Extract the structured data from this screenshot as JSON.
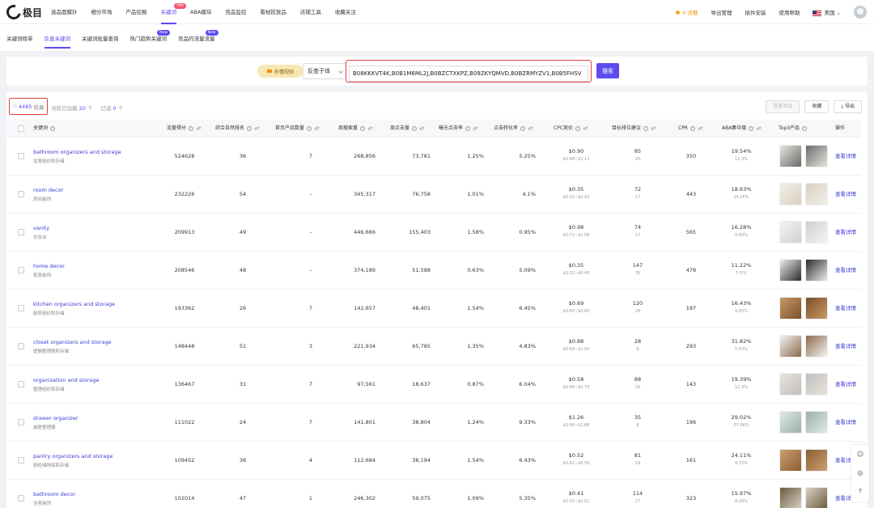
{
  "logo": {
    "text": "极目"
  },
  "nav": {
    "items": [
      {
        "label": "选品面膜针"
      },
      {
        "label": "细分市场"
      },
      {
        "label": "产品挖掘"
      },
      {
        "label": "关键词",
        "badge": "Hot",
        "active": true
      },
      {
        "label": "ABA模块"
      },
      {
        "label": "竞品监控"
      },
      {
        "label": "看帖投放品"
      },
      {
        "label": "店铺工具"
      },
      {
        "label": "收藏关注"
      }
    ]
  },
  "topright": {
    "coin": "0 点数",
    "export": "导出管理",
    "plugin": "插件安装",
    "help": "使用帮助",
    "country": "美国"
  },
  "subtabs": [
    {
      "label": "关键词榜单"
    },
    {
      "label": "反查关键词",
      "active": true
    },
    {
      "label": "关键词批量查询"
    },
    {
      "label": "热门趋势关键词",
      "badge": "New"
    },
    {
      "label": "竞品的流量流量",
      "badge": "New"
    }
  ],
  "search": {
    "video_label": "秒懂视频",
    "type_value": "反查子体",
    "asin_value": "B08KKKVT4K,B0B1M6ML2J,B0BZCTXKPZ,B09ZKYQMVD,B0BZRMYZV1,B0B5FHSV",
    "button": "搜索"
  },
  "summary": {
    "count": "4485",
    "count_label": "结果",
    "page_label": "当前已加载",
    "page_count": "20",
    "page_unit": "个",
    "selected_label": "已选",
    "selected_count": "0",
    "selected_unit": "个"
  },
  "actions": {
    "batch": "批量添加",
    "collect": "收藏",
    "export": "导出"
  },
  "columns": [
    "关键词",
    "流量得分",
    "综合自然排名",
    "首页产品数量",
    "周搜索量",
    "周点击量",
    "曝光点击率",
    "点击转化率",
    "CPC竞价",
    "目标排位建议",
    "CPR",
    "ABA集中度",
    "Top3产品",
    "操作"
  ],
  "rows": [
    {
      "en": "bathroom organizers and storage",
      "cn": "浴室组织和存储",
      "score": "524628",
      "rank": "36",
      "first": "7",
      "search": "268,856",
      "click": "73,781",
      "ctr": "1.25%",
      "cvr": "5.25%",
      "cpc": "$0.90",
      "cpc_range": "$0.68~$1.13",
      "target": "85",
      "target_sub": "20",
      "cpr": "350",
      "aba": "19.54%",
      "aba_sub": "11.3%",
      "link": "查看详情"
    },
    {
      "en": "room decor",
      "cn": "房间装饰",
      "score": "232226",
      "rank": "54",
      "first": "–",
      "search": "345,317",
      "click": "76,758",
      "ctr": "1.01%",
      "cvr": "4.1%",
      "cpc": "$0.35",
      "cpc_range": "$0.32~$0.42",
      "target": "72",
      "target_sub": "17",
      "cpr": "443",
      "aba": "18.63%",
      "aba_sub": "14.26%",
      "link": "查看详情"
    },
    {
      "en": "vanity",
      "cn": "化妆台",
      "score": "209913",
      "rank": "49",
      "first": "–",
      "search": "446,666",
      "click": "155,403",
      "ctr": "1.58%",
      "cvr": "0.95%",
      "cpc": "$0.98",
      "cpc_range": "$0.72~$1.08",
      "target": "74",
      "target_sub": "17",
      "cpr": "565",
      "aba": "16.28%",
      "aba_sub": "9.83%",
      "link": "查看详情"
    },
    {
      "en": "home decor",
      "cn": "家居装饰",
      "score": "208546",
      "rank": "48",
      "first": "–",
      "search": "374,189",
      "click": "51,588",
      "ctr": "0.63%",
      "cvr": "5.09%",
      "cpc": "$0.35",
      "cpc_range": "$0.32~$0.40",
      "target": "147",
      "target_sub": "35",
      "cpr": "478",
      "aba": "11.22%",
      "aba_sub": "5.5%",
      "link": "查看详情"
    },
    {
      "en": "kitchen organizers and storage",
      "cn": "厨房组织和存储",
      "score": "193362",
      "rank": "26",
      "first": "7",
      "search": "142,657",
      "click": "48,401",
      "ctr": "1.54%",
      "cvr": "6.45%",
      "cpc": "$0.69",
      "cpc_range": "$0.60~$0.80",
      "target": "120",
      "target_sub": "28",
      "cpr": "197",
      "aba": "16.43%",
      "aba_sub": "9.83%",
      "link": "查看详情"
    },
    {
      "en": "closet organizers and storage",
      "cn": "壁橱整理器和存储",
      "score": "148448",
      "rank": "51",
      "first": "3",
      "search": "221,934",
      "click": "65,785",
      "ctr": "1.35%",
      "cvr": "4.83%",
      "cpc": "$0.88",
      "cpc_range": "$0.69~$1.04",
      "target": "28",
      "target_sub": "6",
      "cpr": "293",
      "aba": "31.82%",
      "aba_sub": "5.03%",
      "link": "查看详情"
    },
    {
      "en": "organization and storage",
      "cn": "整理组织和存储",
      "score": "136467",
      "rank": "31",
      "first": "7",
      "search": "97,561",
      "click": "18,637",
      "ctr": "0.87%",
      "cvr": "6.04%",
      "cpc": "$0.58",
      "cpc_range": "$0.48~$0.73",
      "target": "88",
      "target_sub": "20",
      "cpr": "143",
      "aba": "19.39%",
      "aba_sub": "12.3%",
      "link": "查看详情"
    },
    {
      "en": "drawer organizer",
      "cn": "抽屉整理器",
      "score": "111022",
      "rank": "24",
      "first": "7",
      "search": "141,801",
      "click": "38,804",
      "ctr": "1.24%",
      "cvr": "9.33%",
      "cpc": "$1.26",
      "cpc_range": "$0.90~$1.68",
      "target": "35",
      "target_sub": "8",
      "cpr": "196",
      "aba": "29.02%",
      "aba_sub": "27.06%",
      "link": "查看详情"
    },
    {
      "en": "pantry organizers and storage",
      "cn": "厨柜储物架和存储",
      "score": "109452",
      "rank": "36",
      "first": "4",
      "search": "112,684",
      "click": "38,194",
      "ctr": "1.54%",
      "cvr": "6.43%",
      "cpc": "$0.52",
      "cpc_range": "$0.42~$0.59",
      "target": "81",
      "target_sub": "19",
      "cpr": "161",
      "aba": "24.11%",
      "aba_sub": "9.72%",
      "link": "查看详情"
    },
    {
      "en": "bathroom decor",
      "cn": "浴室装饰",
      "score": "102014",
      "rank": "47",
      "first": "1",
      "search": "246,302",
      "click": "59,075",
      "ctr": "1.09%",
      "cvr": "5.35%",
      "cpc": "$0.41",
      "cpc_range": "$0.32~$2.51",
      "target": "114",
      "target_sub": "27",
      "cpr": "323",
      "aba": "15.97%",
      "aba_sub": "8.16%",
      "link": "查看详情"
    }
  ],
  "colors": {
    "accent": "#5b4cf0",
    "highlight_border": "#e0413d",
    "link": "#3b3bd6",
    "hot": "#f5556b"
  }
}
